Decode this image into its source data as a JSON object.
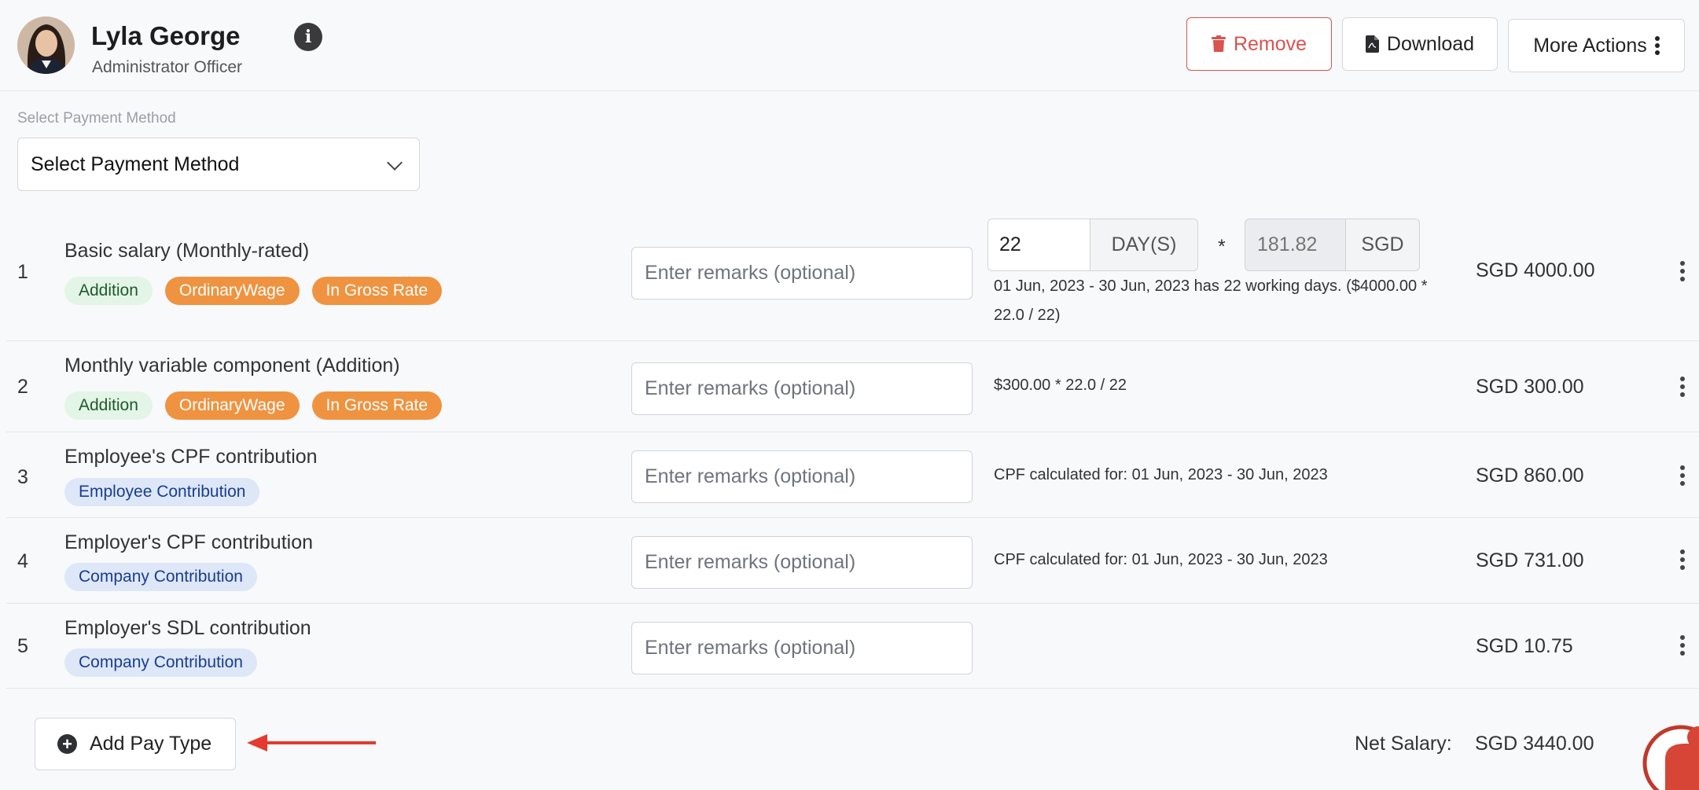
{
  "header": {
    "name": "Lyla George",
    "role": "Administrator Officer",
    "info_icon": "info-circle-icon",
    "actions": {
      "remove": "Remove",
      "download": "Download",
      "more": "More Actions"
    }
  },
  "payment_method": {
    "label": "Select Payment Method",
    "selected": "Select Payment Method"
  },
  "remarks_placeholder": "Enter remarks (optional)",
  "rows": [
    {
      "num": "1",
      "title": "Basic salary (Monthly-rated)",
      "badges": [
        "Addition",
        "OrdinaryWage",
        "In Gross Rate"
      ],
      "days_value": "22",
      "days_unit": "DAY(S)",
      "multiply": "*",
      "rate_placeholder": "181.82",
      "rate_unit": "SGD",
      "calc_line1": "01 Jun, 2023 - 30 Jun, 2023 has 22 working days. ($4000.00 *",
      "calc_line2": "22.0 / 22)",
      "amount": "SGD 4000.00"
    },
    {
      "num": "2",
      "title": "Monthly variable component (Addition)",
      "badges": [
        "Addition",
        "OrdinaryWage",
        "In Gross Rate"
      ],
      "calc": "$300.00 * 22.0 / 22",
      "amount": "SGD 300.00"
    },
    {
      "num": "3",
      "title": "Employee's CPF contribution",
      "badges": [
        "Employee Contribution"
      ],
      "calc": "CPF calculated for: 01 Jun, 2023 - 30 Jun, 2023",
      "amount": "SGD 860.00"
    },
    {
      "num": "4",
      "title": "Employer's CPF contribution",
      "badges": [
        "Company Contribution"
      ],
      "calc": "CPF calculated for: 01 Jun, 2023 - 30 Jun, 2023",
      "amount": "SGD 731.00"
    },
    {
      "num": "5",
      "title": "Employer's SDL contribution",
      "badges": [
        "Company Contribution"
      ],
      "amount": "SGD 10.75"
    }
  ],
  "footer": {
    "add_label": "Add Pay Type",
    "net_label": "Net Salary:",
    "net_value": "SGD 3440.00"
  },
  "colors": {
    "remove": "#d9534f",
    "orange_badge": "#ef9341",
    "addition_badge": "#e3f5e6",
    "blue_badge": "#dde7f8",
    "arrow": "#e53a2f"
  }
}
